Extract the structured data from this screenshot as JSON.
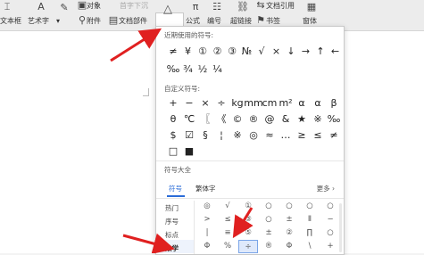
{
  "toolbar": {
    "text_box": "文本框",
    "art_text": "艺术字",
    "drop_cap": "首字下沉",
    "object": "对象",
    "attachment": "附件",
    "doc_parts": "文档部件",
    "symbol": "符号",
    "formula": "公式",
    "numbering": "编号",
    "hyperlink": "超链接",
    "cross_ref": "文档引用",
    "bookmark": "书签",
    "form": "窗体"
  },
  "panel": {
    "recent_title": "近期使用的符号:",
    "recent_symbols": [
      "≠",
      "¥",
      "①",
      "②",
      "③",
      "№",
      "√",
      "×",
      "↓",
      "→",
      "↑",
      "←",
      "‰",
      "¾",
      "½",
      "¼"
    ],
    "custom_title": "自定义符号:",
    "custom_symbols": [
      "+",
      "−",
      "×",
      "÷",
      "kg",
      "mm",
      "cm",
      "m²",
      "α",
      "α",
      "β",
      "θ",
      "℃",
      "〖",
      "《",
      "©",
      "®",
      "@",
      "&",
      "★",
      "※",
      "‰",
      "$",
      "☑",
      "§",
      "¦",
      "※",
      "◎",
      "≈",
      "…",
      "≥",
      "≤",
      "≠",
      "□",
      "■",
      "",
      "",
      "",
      "",
      "",
      "",
      "",
      "",
      ""
    ],
    "all_title": "符号大全",
    "tabs": [
      "符号",
      "繁体字"
    ],
    "more": "更多",
    "categories": [
      "热门",
      "序号",
      "标点",
      "数学"
    ],
    "all_symbols": [
      [
        "◎",
        "√",
        "①",
        "○",
        "○",
        "○",
        "○"
      ],
      [
        ">",
        "≤",
        "③",
        "○",
        "±",
        "Ⅱ",
        "−"
      ],
      [
        "|",
        "≡",
        "⑤",
        "±",
        "②",
        "∏",
        "○"
      ],
      [
        "Φ",
        "%",
        "÷",
        "®",
        "Φ",
        "\\",
        "+"
      ]
    ]
  }
}
